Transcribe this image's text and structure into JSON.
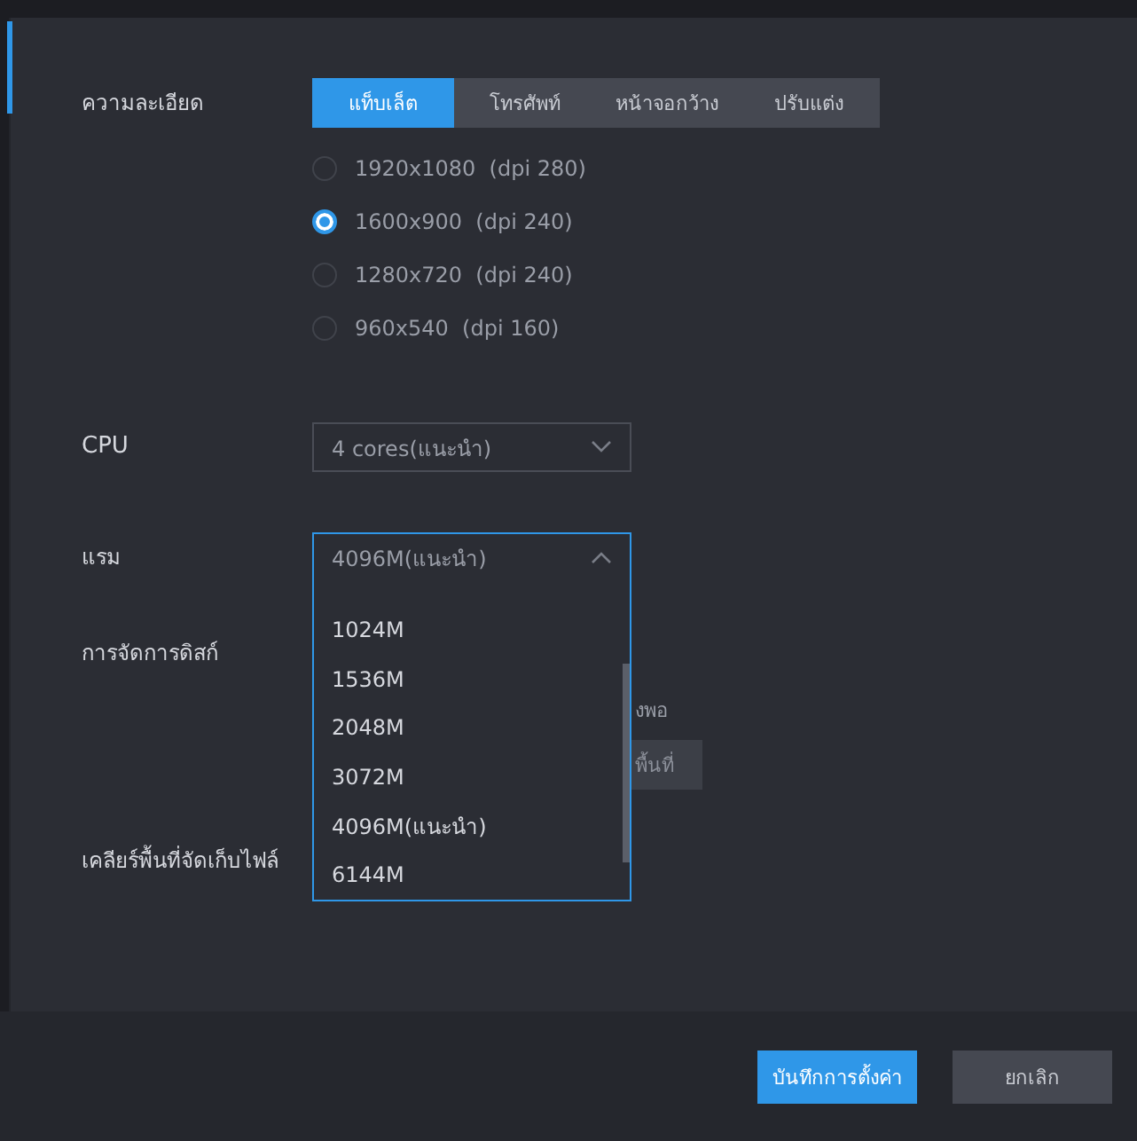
{
  "resolution": {
    "label": "ความละเอียด",
    "tabs": [
      {
        "label": "แท็บเล็ต",
        "selected": true
      },
      {
        "label": "โทรศัพท์",
        "selected": false
      },
      {
        "label": "หน้าจอกว้าง",
        "selected": false
      },
      {
        "label": "ปรับแต่ง",
        "selected": false
      }
    ],
    "options": [
      {
        "label": "1920x1080  (dpi 280)",
        "selected": false
      },
      {
        "label": "1600x900  (dpi 240)",
        "selected": true
      },
      {
        "label": "1280x720  (dpi 240)",
        "selected": false
      },
      {
        "label": "960x540  (dpi 160)",
        "selected": false
      }
    ]
  },
  "cpu": {
    "label": "CPU",
    "value": "4 cores(แนะนำ)"
  },
  "ram": {
    "label": "แรม",
    "value": "4096M(แนะนำ)",
    "expanded": true,
    "options": [
      "1024M",
      "1536M",
      "2048M",
      "3072M",
      "4096M(แนะนำ)",
      "6144M"
    ]
  },
  "disk": {
    "label": "การจัดการดิสก์",
    "note": "งพอ",
    "button": "พื้นที่"
  },
  "clear_storage": {
    "label": "เคลียร์พื้นที่จัดเก็บไฟล์"
  },
  "footer": {
    "buttons": [
      {
        "label": "บันทึกการตั้งค่า",
        "kind": "primary"
      },
      {
        "label": "ยกเลิก",
        "kind": "secondary"
      }
    ]
  }
}
